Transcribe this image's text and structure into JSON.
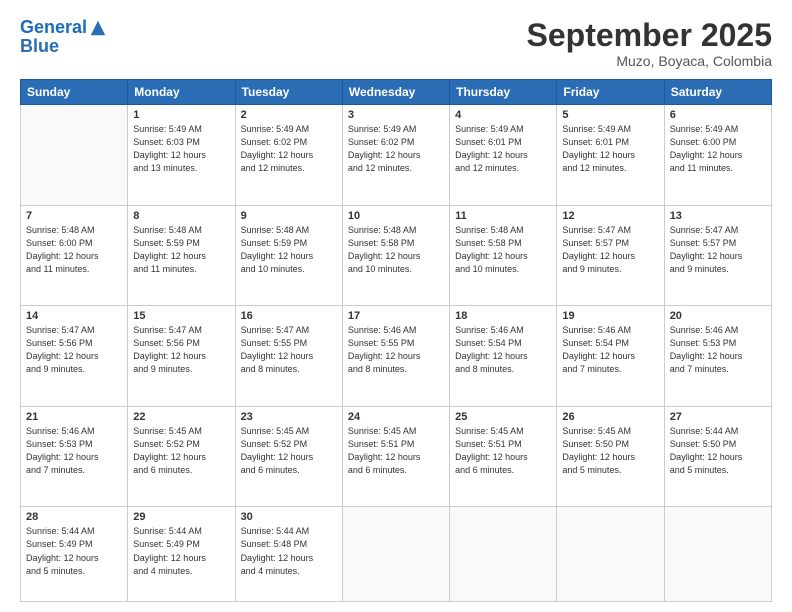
{
  "header": {
    "logo_line1": "General",
    "logo_line2": "Blue",
    "month": "September 2025",
    "location": "Muzo, Boyaca, Colombia"
  },
  "weekdays": [
    "Sunday",
    "Monday",
    "Tuesday",
    "Wednesday",
    "Thursday",
    "Friday",
    "Saturday"
  ],
  "weeks": [
    [
      {
        "day": "",
        "info": ""
      },
      {
        "day": "1",
        "info": "Sunrise: 5:49 AM\nSunset: 6:03 PM\nDaylight: 12 hours\nand 13 minutes."
      },
      {
        "day": "2",
        "info": "Sunrise: 5:49 AM\nSunset: 6:02 PM\nDaylight: 12 hours\nand 12 minutes."
      },
      {
        "day": "3",
        "info": "Sunrise: 5:49 AM\nSunset: 6:02 PM\nDaylight: 12 hours\nand 12 minutes."
      },
      {
        "day": "4",
        "info": "Sunrise: 5:49 AM\nSunset: 6:01 PM\nDaylight: 12 hours\nand 12 minutes."
      },
      {
        "day": "5",
        "info": "Sunrise: 5:49 AM\nSunset: 6:01 PM\nDaylight: 12 hours\nand 12 minutes."
      },
      {
        "day": "6",
        "info": "Sunrise: 5:49 AM\nSunset: 6:00 PM\nDaylight: 12 hours\nand 11 minutes."
      }
    ],
    [
      {
        "day": "7",
        "info": "Sunrise: 5:48 AM\nSunset: 6:00 PM\nDaylight: 12 hours\nand 11 minutes."
      },
      {
        "day": "8",
        "info": "Sunrise: 5:48 AM\nSunset: 5:59 PM\nDaylight: 12 hours\nand 11 minutes."
      },
      {
        "day": "9",
        "info": "Sunrise: 5:48 AM\nSunset: 5:59 PM\nDaylight: 12 hours\nand 10 minutes."
      },
      {
        "day": "10",
        "info": "Sunrise: 5:48 AM\nSunset: 5:58 PM\nDaylight: 12 hours\nand 10 minutes."
      },
      {
        "day": "11",
        "info": "Sunrise: 5:48 AM\nSunset: 5:58 PM\nDaylight: 12 hours\nand 10 minutes."
      },
      {
        "day": "12",
        "info": "Sunrise: 5:47 AM\nSunset: 5:57 PM\nDaylight: 12 hours\nand 9 minutes."
      },
      {
        "day": "13",
        "info": "Sunrise: 5:47 AM\nSunset: 5:57 PM\nDaylight: 12 hours\nand 9 minutes."
      }
    ],
    [
      {
        "day": "14",
        "info": "Sunrise: 5:47 AM\nSunset: 5:56 PM\nDaylight: 12 hours\nand 9 minutes."
      },
      {
        "day": "15",
        "info": "Sunrise: 5:47 AM\nSunset: 5:56 PM\nDaylight: 12 hours\nand 9 minutes."
      },
      {
        "day": "16",
        "info": "Sunrise: 5:47 AM\nSunset: 5:55 PM\nDaylight: 12 hours\nand 8 minutes."
      },
      {
        "day": "17",
        "info": "Sunrise: 5:46 AM\nSunset: 5:55 PM\nDaylight: 12 hours\nand 8 minutes."
      },
      {
        "day": "18",
        "info": "Sunrise: 5:46 AM\nSunset: 5:54 PM\nDaylight: 12 hours\nand 8 minutes."
      },
      {
        "day": "19",
        "info": "Sunrise: 5:46 AM\nSunset: 5:54 PM\nDaylight: 12 hours\nand 7 minutes."
      },
      {
        "day": "20",
        "info": "Sunrise: 5:46 AM\nSunset: 5:53 PM\nDaylight: 12 hours\nand 7 minutes."
      }
    ],
    [
      {
        "day": "21",
        "info": "Sunrise: 5:46 AM\nSunset: 5:53 PM\nDaylight: 12 hours\nand 7 minutes."
      },
      {
        "day": "22",
        "info": "Sunrise: 5:45 AM\nSunset: 5:52 PM\nDaylight: 12 hours\nand 6 minutes."
      },
      {
        "day": "23",
        "info": "Sunrise: 5:45 AM\nSunset: 5:52 PM\nDaylight: 12 hours\nand 6 minutes."
      },
      {
        "day": "24",
        "info": "Sunrise: 5:45 AM\nSunset: 5:51 PM\nDaylight: 12 hours\nand 6 minutes."
      },
      {
        "day": "25",
        "info": "Sunrise: 5:45 AM\nSunset: 5:51 PM\nDaylight: 12 hours\nand 6 minutes."
      },
      {
        "day": "26",
        "info": "Sunrise: 5:45 AM\nSunset: 5:50 PM\nDaylight: 12 hours\nand 5 minutes."
      },
      {
        "day": "27",
        "info": "Sunrise: 5:44 AM\nSunset: 5:50 PM\nDaylight: 12 hours\nand 5 minutes."
      }
    ],
    [
      {
        "day": "28",
        "info": "Sunrise: 5:44 AM\nSunset: 5:49 PM\nDaylight: 12 hours\nand 5 minutes."
      },
      {
        "day": "29",
        "info": "Sunrise: 5:44 AM\nSunset: 5:49 PM\nDaylight: 12 hours\nand 4 minutes."
      },
      {
        "day": "30",
        "info": "Sunrise: 5:44 AM\nSunset: 5:48 PM\nDaylight: 12 hours\nand 4 minutes."
      },
      {
        "day": "",
        "info": ""
      },
      {
        "day": "",
        "info": ""
      },
      {
        "day": "",
        "info": ""
      },
      {
        "day": "",
        "info": ""
      }
    ]
  ]
}
